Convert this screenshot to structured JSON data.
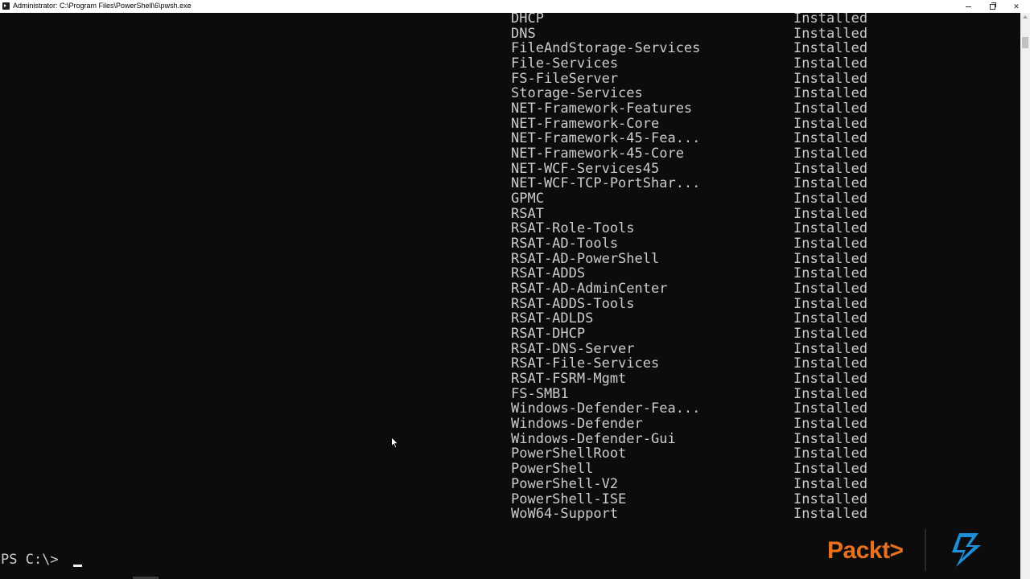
{
  "window": {
    "title": "Administrator: C:\\Program Files\\PowerShell\\6\\pwsh.exe",
    "minimize_label": "",
    "maximize_label": "",
    "close_label": "✕"
  },
  "features": [
    {
      "name": "DHCP",
      "state": "Installed"
    },
    {
      "name": "DNS",
      "state": "Installed"
    },
    {
      "name": "FileAndStorage-Services",
      "state": "Installed"
    },
    {
      "name": "File-Services",
      "state": "Installed"
    },
    {
      "name": "FS-FileServer",
      "state": "Installed"
    },
    {
      "name": "Storage-Services",
      "state": "Installed"
    },
    {
      "name": "NET-Framework-Features",
      "state": "Installed"
    },
    {
      "name": "NET-Framework-Core",
      "state": "Installed"
    },
    {
      "name": "NET-Framework-45-Fea...",
      "state": "Installed"
    },
    {
      "name": "NET-Framework-45-Core",
      "state": "Installed"
    },
    {
      "name": "NET-WCF-Services45",
      "state": "Installed"
    },
    {
      "name": "NET-WCF-TCP-PortShar...",
      "state": "Installed"
    },
    {
      "name": "GPMC",
      "state": "Installed"
    },
    {
      "name": "RSAT",
      "state": "Installed"
    },
    {
      "name": "RSAT-Role-Tools",
      "state": "Installed"
    },
    {
      "name": "RSAT-AD-Tools",
      "state": "Installed"
    },
    {
      "name": "RSAT-AD-PowerShell",
      "state": "Installed"
    },
    {
      "name": "RSAT-ADDS",
      "state": "Installed"
    },
    {
      "name": "RSAT-AD-AdminCenter",
      "state": "Installed"
    },
    {
      "name": "RSAT-ADDS-Tools",
      "state": "Installed"
    },
    {
      "name": "RSAT-ADLDS",
      "state": "Installed"
    },
    {
      "name": "RSAT-DHCP",
      "state": "Installed"
    },
    {
      "name": "RSAT-DNS-Server",
      "state": "Installed"
    },
    {
      "name": "RSAT-File-Services",
      "state": "Installed"
    },
    {
      "name": "RSAT-FSRM-Mgmt",
      "state": "Installed"
    },
    {
      "name": "FS-SMB1",
      "state": "Installed"
    },
    {
      "name": "Windows-Defender-Fea...",
      "state": "Installed"
    },
    {
      "name": "Windows-Defender",
      "state": "Installed"
    },
    {
      "name": "Windows-Defender-Gui",
      "state": "Installed"
    },
    {
      "name": "PowerShellRoot",
      "state": "Installed"
    },
    {
      "name": "PowerShell",
      "state": "Installed"
    },
    {
      "name": "PowerShell-V2",
      "state": "Installed"
    },
    {
      "name": "PowerShell-ISE",
      "state": "Installed"
    },
    {
      "name": "WoW64-Support",
      "state": "Installed"
    }
  ],
  "prompt": {
    "text": "PS C:\\>"
  },
  "branding": {
    "packt_text": "Packt>",
    "packt_color": "#e8701f",
    "bolt_color": "#1e8fd6"
  },
  "colors": {
    "terminal_bg": "#0c0c0c",
    "terminal_fg": "#cccccc"
  }
}
